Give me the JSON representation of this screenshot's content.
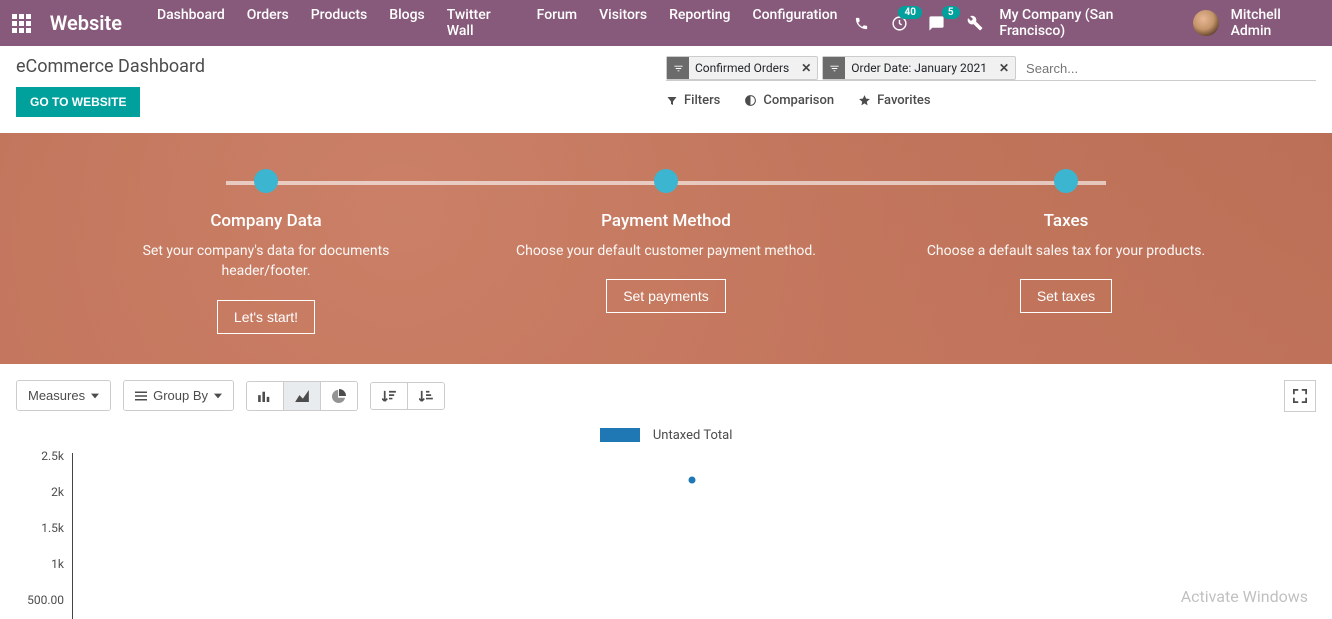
{
  "topbar": {
    "brand": "Website",
    "nav": [
      "Dashboard",
      "Orders",
      "Products",
      "Blogs",
      "Twitter Wall",
      "Forum",
      "Visitors",
      "Reporting",
      "Configuration"
    ],
    "clock_badge": "40",
    "chat_badge": "5",
    "company": "My Company (San Francisco)",
    "user": "Mitchell Admin"
  },
  "header": {
    "title": "eCommerce Dashboard",
    "go_btn": "GO TO WEBSITE"
  },
  "search": {
    "facets": [
      {
        "label": "Confirmed Orders"
      },
      {
        "label": "Order Date: January 2021"
      }
    ],
    "placeholder": "Search...",
    "filters_label": "Filters",
    "comparison_label": "Comparison",
    "favorites_label": "Favorites"
  },
  "onboarding": {
    "steps": [
      {
        "title": "Company Data",
        "desc": "Set your company's data for documents header/footer.",
        "btn": "Let's start!"
      },
      {
        "title": "Payment Method",
        "desc": "Choose your default customer payment method.",
        "btn": "Set payments"
      },
      {
        "title": "Taxes",
        "desc": "Choose a default sales tax for your products.",
        "btn": "Set taxes"
      }
    ]
  },
  "toolbar": {
    "measures": "Measures",
    "groupby": "Group By"
  },
  "chart_data": {
    "type": "line",
    "legend": "Untaxed Total",
    "yticks": [
      "2.5k",
      "2k",
      "1.5k",
      "1k",
      "500.00"
    ],
    "ylim": [
      0,
      2500
    ],
    "series": [
      {
        "name": "Untaxed Total",
        "points": [
          {
            "x_frac": 0.498,
            "y": 2150
          }
        ]
      }
    ]
  },
  "watermark": "Activate Windows"
}
